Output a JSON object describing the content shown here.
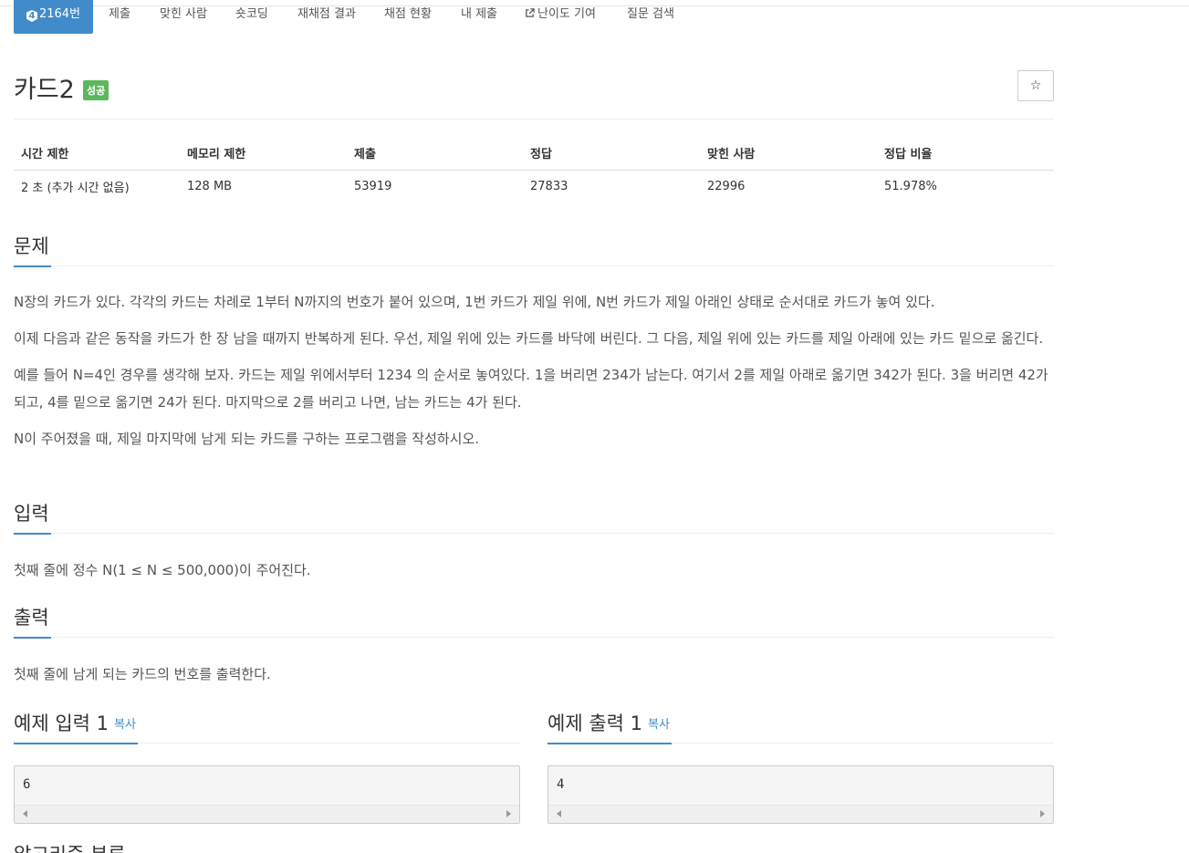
{
  "nav": {
    "tier_glyph": "4",
    "problem_tab": "2164번",
    "tabs": [
      "제출",
      "맞힌 사람",
      "숏코딩",
      "재채점 결과",
      "채점 현황",
      "내 제출",
      "난이도 기여",
      "질문 검색"
    ]
  },
  "problem": {
    "title": "카드2",
    "badge": "성공",
    "star_glyph": "☆"
  },
  "info": {
    "headers": [
      "시간 제한",
      "메모리 제한",
      "제출",
      "정답",
      "맞힌 사람",
      "정답 비율"
    ],
    "values": [
      "2 초 (추가 시간 없음)",
      "128 MB",
      "53919",
      "27833",
      "22996",
      "51.978%"
    ]
  },
  "sections": {
    "description": {
      "title": "문제",
      "paragraphs": [
        "N장의 카드가 있다. 각각의 카드는 차례로 1부터 N까지의 번호가 붙어 있으며, 1번 카드가 제일 위에, N번 카드가 제일 아래인 상태로 순서대로 카드가 놓여 있다.",
        "이제 다음과 같은 동작을 카드가 한 장 남을 때까지 반복하게 된다. 우선, 제일 위에 있는 카드를 바닥에 버린다. 그 다음, 제일 위에 있는 카드를 제일 아래에 있는 카드 밑으로 옮긴다.",
        "예를 들어 N=4인 경우를 생각해 보자. 카드는 제일 위에서부터 1234 의 순서로 놓여있다. 1을 버리면 234가 남는다. 여기서 2를 제일 아래로 옮기면 342가 된다. 3을 버리면 42가 되고, 4를 밑으로 옮기면 24가 된다. 마지막으로 2를 버리고 나면, 남는 카드는 4가 된다.",
        "N이 주어졌을 때, 제일 마지막에 남게 되는 카드를 구하는 프로그램을 작성하시오."
      ]
    },
    "input": {
      "title": "입력",
      "text": "첫째 줄에 정수 N(1 ≤ N ≤ 500,000)이 주어진다."
    },
    "output": {
      "title": "출력",
      "text": "첫째 줄에 남게 되는 카드의 번호를 출력한다."
    },
    "sample_input": {
      "title": "예제 입력 1",
      "copy": "복사",
      "value": "6"
    },
    "sample_output": {
      "title": "예제 출력 1",
      "copy": "복사",
      "value": "4"
    },
    "next_partial": "알고리즘 분류"
  }
}
